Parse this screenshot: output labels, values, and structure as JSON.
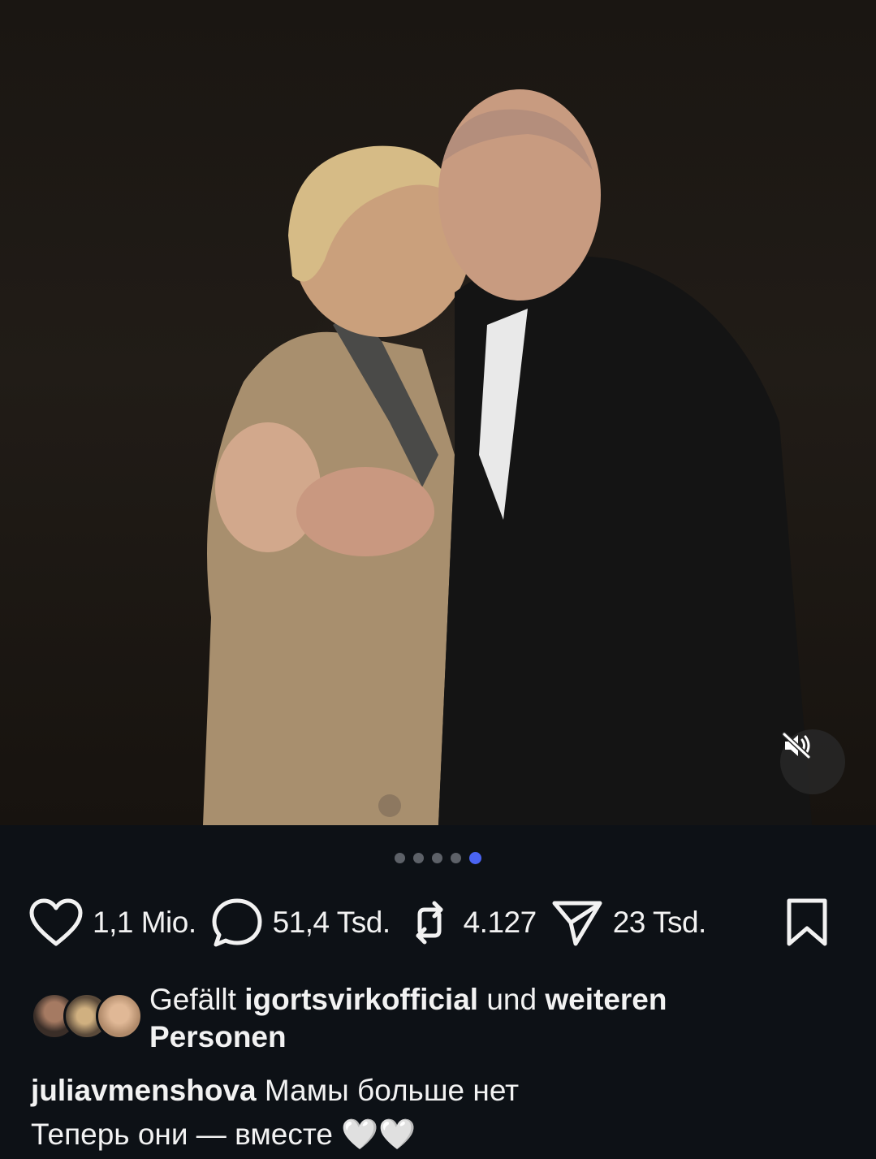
{
  "post": {
    "dots_total": 5,
    "active_dot": 5,
    "muted": true
  },
  "actions": {
    "likes": "1,1 Mio.",
    "comments": "51,4 Tsd.",
    "reposts": "4.127",
    "shares": "23 Tsd."
  },
  "liked_by": {
    "prefix": "Gefällt",
    "user": "igortsvirkofficial",
    "middle": "und",
    "suffix_bold_1": "weiteren",
    "suffix_bold_2": "Personen"
  },
  "caption": {
    "username": "juliavmenshova",
    "line1": "Мамы больше нет",
    "line2": "Теперь они — вместе 🤍🤍"
  },
  "colors": {
    "background": "#0d1116",
    "active_dot": "#4a64f2",
    "text": "#f2f2f2"
  }
}
